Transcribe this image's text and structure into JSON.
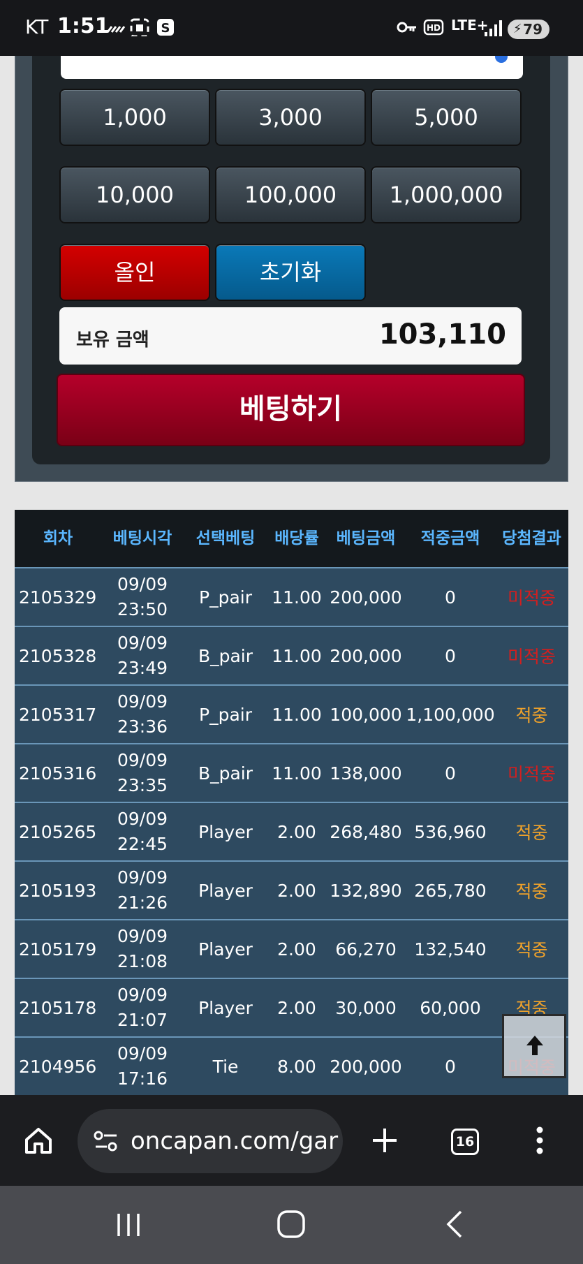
{
  "status_bar": {
    "carrier": "KT",
    "time": "1:51",
    "network": "LTE+",
    "battery": "79",
    "icons": [
      "signal-strike-icon",
      "screenshot-icon",
      "samsung-s-icon",
      "key-icon",
      "hd-icon",
      "lte-icon",
      "signal-bars-icon",
      "battery-icon"
    ]
  },
  "bet_panel": {
    "chips_row1": [
      "1,000",
      "3,000",
      "5,000"
    ],
    "chips_row2": [
      "10,000",
      "100,000",
      "1,000,000"
    ],
    "allin_label": "올인",
    "reset_label": "초기화",
    "balance_label": "보유 금액",
    "balance_value": "103,110",
    "bet_button_label": "베팅하기"
  },
  "history": {
    "columns": [
      "회차",
      "베팅시각",
      "선택베팅",
      "배당률",
      "베팅금액",
      "적중금액",
      "당첨결과"
    ],
    "rows": [
      {
        "round": "2105329",
        "date": "09/09",
        "time": "23:50",
        "pick": "P_pair",
        "odds": "11.00",
        "amount": "200,000",
        "win": "0",
        "result": "미적중",
        "hit": false
      },
      {
        "round": "2105328",
        "date": "09/09",
        "time": "23:49",
        "pick": "B_pair",
        "odds": "11.00",
        "amount": "200,000",
        "win": "0",
        "result": "미적중",
        "hit": false
      },
      {
        "round": "2105317",
        "date": "09/09",
        "time": "23:36",
        "pick": "P_pair",
        "odds": "11.00",
        "amount": "100,000",
        "win": "1,100,000",
        "result": "적중",
        "hit": true
      },
      {
        "round": "2105316",
        "date": "09/09",
        "time": "23:35",
        "pick": "B_pair",
        "odds": "11.00",
        "amount": "138,000",
        "win": "0",
        "result": "미적중",
        "hit": false
      },
      {
        "round": "2105265",
        "date": "09/09",
        "time": "22:45",
        "pick": "Player",
        "odds": "2.00",
        "amount": "268,480",
        "win": "536,960",
        "result": "적중",
        "hit": true
      },
      {
        "round": "2105193",
        "date": "09/09",
        "time": "21:26",
        "pick": "Player",
        "odds": "2.00",
        "amount": "132,890",
        "win": "265,780",
        "result": "적중",
        "hit": true
      },
      {
        "round": "2105179",
        "date": "09/09",
        "time": "21:08",
        "pick": "Player",
        "odds": "2.00",
        "amount": "66,270",
        "win": "132,540",
        "result": "적중",
        "hit": true
      },
      {
        "round": "2105178",
        "date": "09/09",
        "time": "21:07",
        "pick": "Player",
        "odds": "2.00",
        "amount": "30,000",
        "win": "60,000",
        "result": "적중",
        "hit": true
      },
      {
        "round": "2104956",
        "date": "09/09",
        "time": "17:16",
        "pick": "Tie",
        "odds": "8.00",
        "amount": "200,000",
        "win": "0",
        "result": "미적중",
        "hit": false
      }
    ],
    "colors": {
      "hit": "#f0a22a",
      "miss": "#d21f1f",
      "header_text": "#5bb7ff"
    }
  },
  "browser": {
    "url": "oncapan.com/gar",
    "tab_count": "16"
  }
}
